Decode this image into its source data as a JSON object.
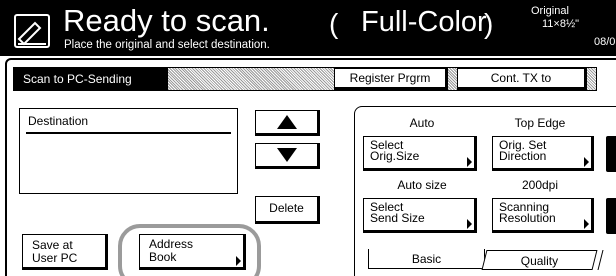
{
  "header": {
    "status_title": "Ready to scan.",
    "status_subtitle": "Place the original and select destination.",
    "mode_open": "(",
    "mode": "Full-Color",
    "mode_close": ")",
    "original_label": "Original",
    "original_size": "11×8½\"",
    "date": "08/0"
  },
  "function_bar": {
    "mode_tag": "Scan to PC-Sending",
    "register_label": "Register Prgrm",
    "cont_tx_label": "Cont. TX to"
  },
  "destination": {
    "title": "Destination",
    "scroll_up_icon": "arrow-up-icon",
    "scroll_down_icon": "arrow-down-icon",
    "delete_label": "Delete"
  },
  "bottom_buttons": {
    "save_line1": "Save at",
    "save_line2": "User PC",
    "address_line1": "Address",
    "address_line2": "Book"
  },
  "settings": {
    "orig_size_value": "Auto",
    "orig_size_line1": "Select",
    "orig_size_line2": "Orig.Size",
    "direction_value": "Top Edge",
    "direction_line1": "Orig. Set",
    "direction_line2": "Direction",
    "send_size_value": "Auto size",
    "send_size_line1": "Select",
    "send_size_line2": "Send Size",
    "resolution_value": "200dpi",
    "resolution_line1": "Scanning",
    "resolution_line2": "Resolution"
  },
  "tabs": [
    {
      "label": "Basic",
      "active": true
    },
    {
      "label": "Quality",
      "active": false
    }
  ],
  "colors": {
    "header_bg": "#000000",
    "highlight_ring": "#9b9b9b"
  }
}
